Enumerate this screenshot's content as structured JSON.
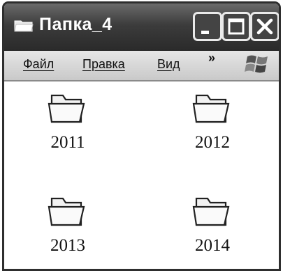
{
  "window": {
    "title": "Папка_4",
    "controls": {
      "minimize": "minimize-icon",
      "maximize": "maximize-icon",
      "close": "close-icon"
    }
  },
  "menu": {
    "items": [
      "Файл",
      "Правка",
      "Вид"
    ],
    "overflow": "»"
  },
  "folders": [
    {
      "name": "2011",
      "icon": "folder-icon"
    },
    {
      "name": "2012",
      "icon": "folder-icon"
    },
    {
      "name": "2013",
      "icon": "folder-icon"
    },
    {
      "name": "2014",
      "icon": "folder-icon"
    }
  ],
  "colors": {
    "titlebar": "#3c3c3c",
    "menubar": "#d6d6d6",
    "background": "#ffffff"
  }
}
